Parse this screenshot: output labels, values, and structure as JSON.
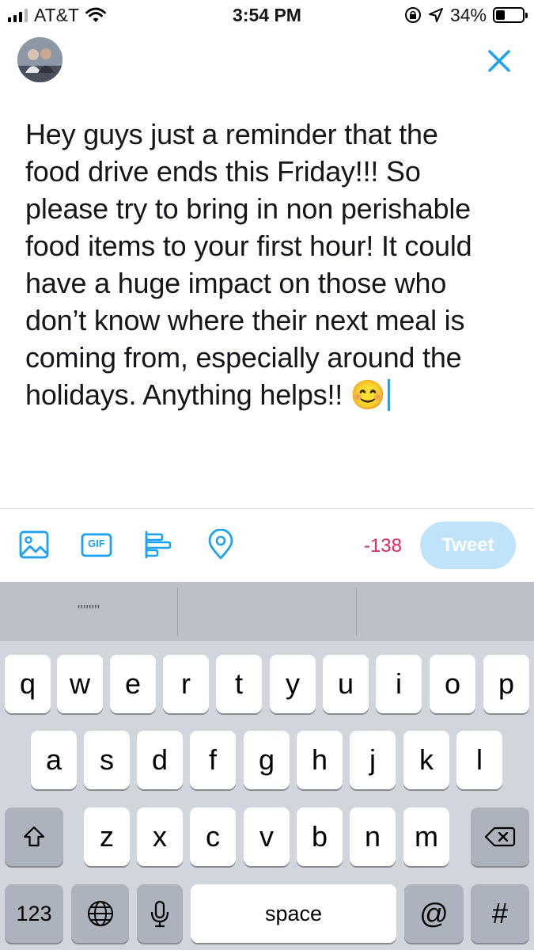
{
  "status_bar": {
    "carrier": "AT&T",
    "time": "3:54 PM",
    "battery_percent": "34%",
    "battery_level": 0.34,
    "icons": [
      "signal-icon",
      "wifi-icon",
      "orientation-lock-icon",
      "location-icon",
      "battery-icon"
    ]
  },
  "compose": {
    "close_icon": "close-icon",
    "text_lines": [
      "Hey guys just a reminder that the",
      "food drive ends this Friday!!! So",
      "please try to bring in non perishable",
      "food items to your first hour! It could",
      "have a huge impact on those who",
      "don’t know where their next meal is",
      "coming from, especially around the",
      "holidays. Anything helps!! 😊"
    ]
  },
  "toolbar": {
    "icons": [
      "image-icon",
      "gif-icon",
      "poll-icon",
      "location-pin-icon"
    ],
    "gif_label": "GIF",
    "char_count": "-138",
    "tweet_label": "Tweet",
    "colors": {
      "accent": "#1da1f2",
      "tweet_disabled": "#bfe3fb",
      "count_over": "#e0245e"
    }
  },
  "keyboard": {
    "predictions": [
      "\"\"\"\"",
      "",
      ""
    ],
    "row1": [
      "q",
      "w",
      "e",
      "r",
      "t",
      "y",
      "u",
      "i",
      "o",
      "p"
    ],
    "row2": [
      "a",
      "s",
      "d",
      "f",
      "g",
      "h",
      "j",
      "k",
      "l"
    ],
    "row3": [
      "z",
      "x",
      "c",
      "v",
      "b",
      "n",
      "m"
    ],
    "numbers_label": "123",
    "space_label": "space",
    "at_label": "@",
    "hash_label": "#",
    "icons": [
      "shift-icon",
      "delete-icon",
      "globe-icon",
      "microphone-icon"
    ]
  }
}
